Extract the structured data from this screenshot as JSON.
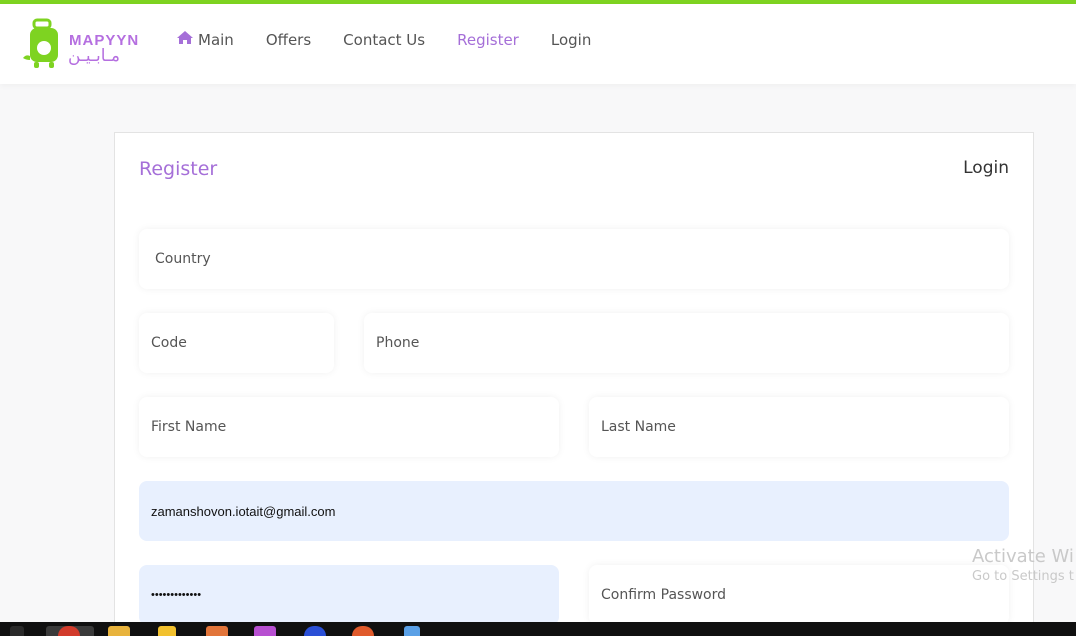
{
  "brand": {
    "name": "MAPYYN",
    "arabic": "مـابـيـن",
    "colors": {
      "accent": "#a56fd8",
      "logo_green": "#7ed321",
      "logo_purple": "#b56fe0"
    }
  },
  "nav": {
    "items": [
      {
        "label": "Main",
        "icon": "home-icon",
        "active": false
      },
      {
        "label": "Offers",
        "active": false
      },
      {
        "label": "Contact Us",
        "active": false
      },
      {
        "label": "Register",
        "active": true
      },
      {
        "label": "Login",
        "active": false
      }
    ]
  },
  "card": {
    "tab_register": "Register",
    "tab_login": "Login"
  },
  "form": {
    "country": {
      "placeholder": "Country",
      "value": ""
    },
    "code": {
      "placeholder": "Code",
      "value": ""
    },
    "phone": {
      "placeholder": "Phone",
      "value": ""
    },
    "first_name": {
      "placeholder": "First Name",
      "value": ""
    },
    "last_name": {
      "placeholder": "Last Name",
      "value": ""
    },
    "email": {
      "value": "zamanshovon.iotait@gmail.com"
    },
    "password": {
      "value": "•••••••••••••"
    },
    "confirm_password": {
      "placeholder": "Confirm Password",
      "value": ""
    }
  },
  "watermark": {
    "line1": "Activate Wi",
    "line2": "Go to Settings t"
  }
}
